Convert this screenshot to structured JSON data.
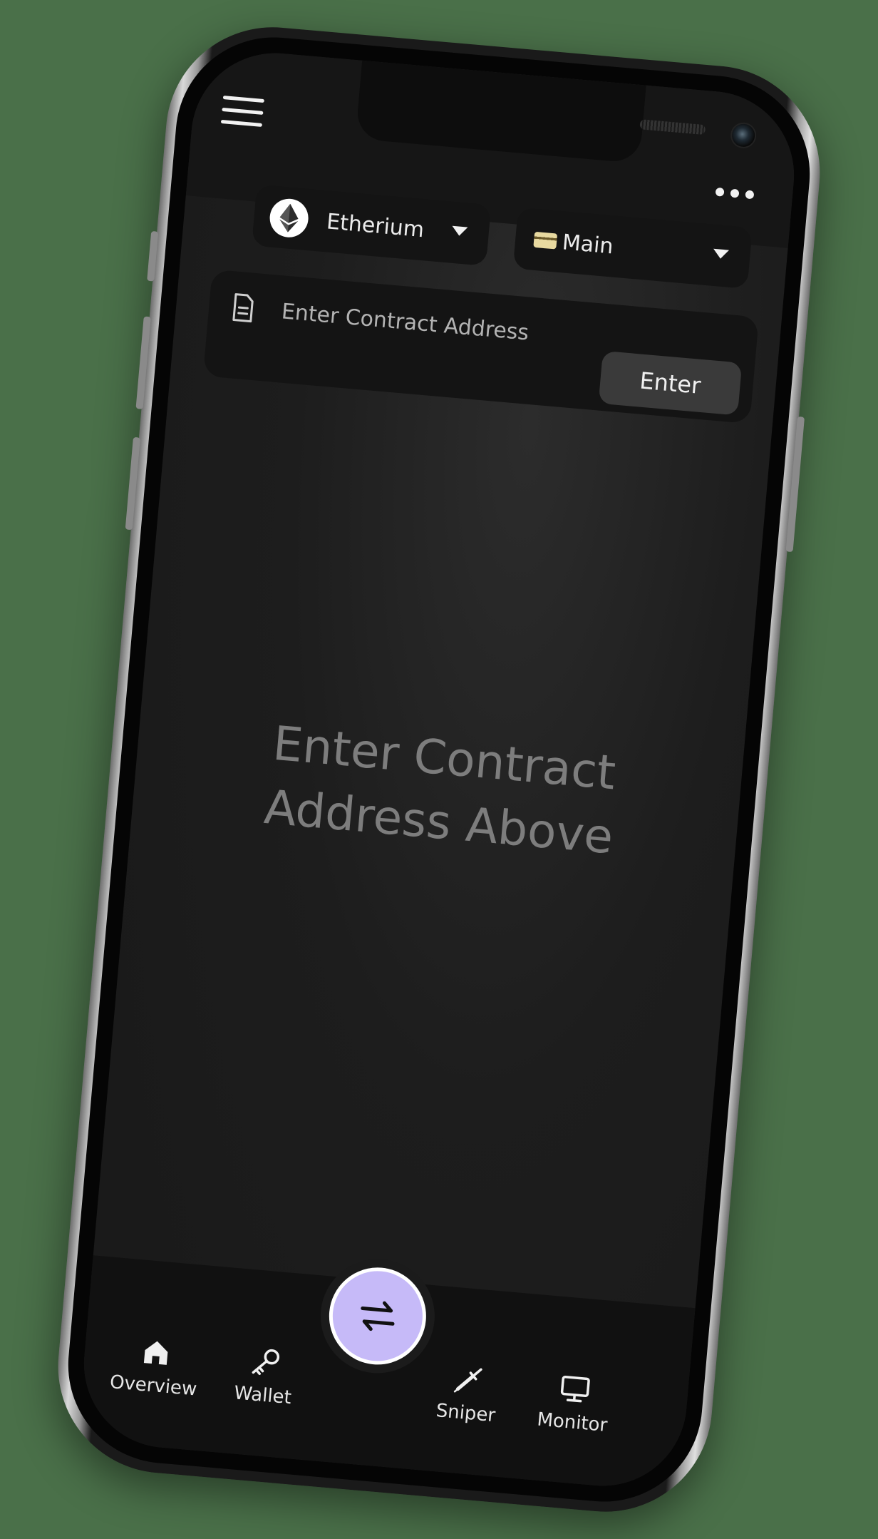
{
  "header": {
    "menu_icon": "hamburger-icon",
    "more_icon": "ellipsis-icon"
  },
  "selectors": {
    "chain_label": "Etherium",
    "chain_icon": "ethereum-icon",
    "wallet_label": "Main",
    "wallet_icon": "credit-card-icon",
    "dropdown_icon": "caret-down-icon"
  },
  "contract": {
    "placeholder": "Enter Contract Address",
    "icon": "document-icon",
    "enter_label": "Enter"
  },
  "empty_state": {
    "line1": "Enter Contract",
    "line2": "Address Above"
  },
  "bottom_nav": {
    "overview": "Overview",
    "wallet": "Wallet",
    "sniper": "Sniper",
    "monitor": "Monitor",
    "swap_icon": "swap-arrows-icon"
  },
  "colors": {
    "background": "#4a7049",
    "screen": "#1d1d1d",
    "accent": "#c6baf8",
    "text_muted": "#7d7d7d"
  }
}
